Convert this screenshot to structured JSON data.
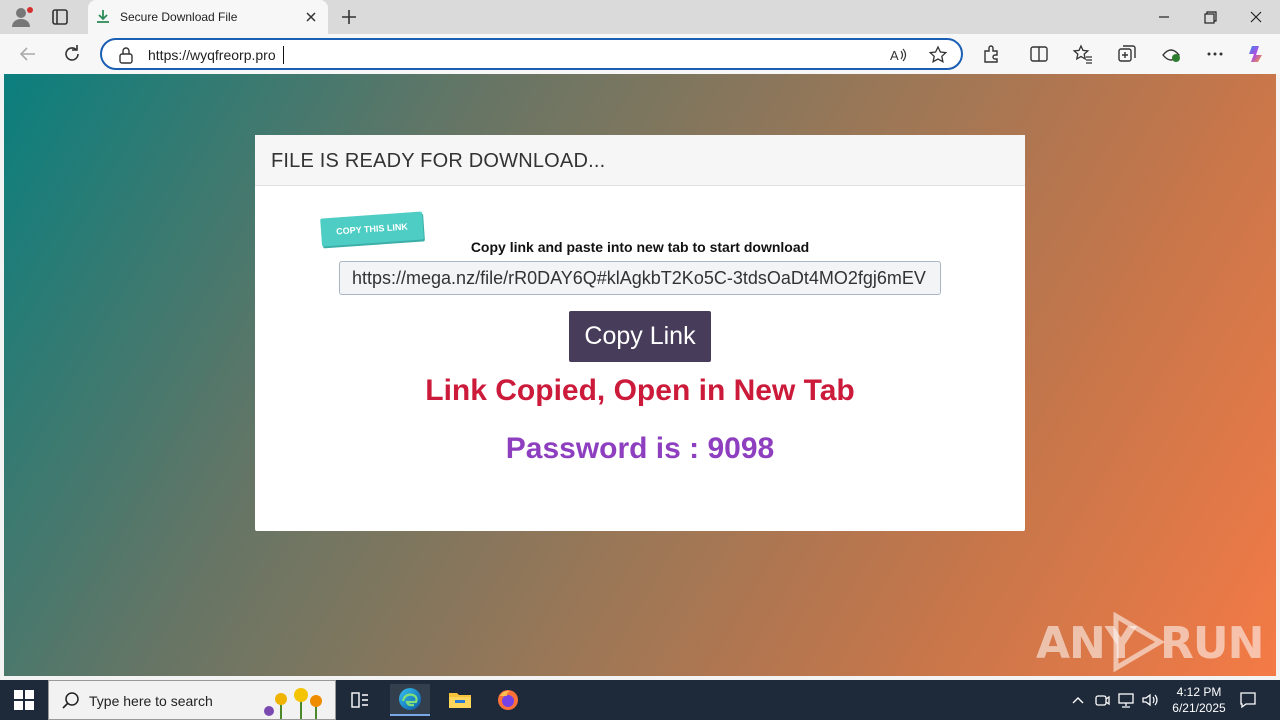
{
  "browser": {
    "tab": {
      "title": "Secure Download File"
    },
    "address": {
      "url": "https://wyqfreorp.pro"
    }
  },
  "page": {
    "header_title": "FILE IS READY FOR DOWNLOAD...",
    "badge_label": "COPY THIS LINK",
    "instruction": "Copy link and paste into new tab to start download",
    "link_value": "https://mega.nz/file/rR0DAY6Q#klAgkbT2Ko5C-3tdsOaDt4MO2fgj6mEV",
    "copy_button_label": "Copy Link",
    "copied_message": "Link Copied, Open in New Tab",
    "password_text": "Password is : 9098",
    "colors": {
      "copied": "#cc1a3a",
      "password": "#8e3fc0",
      "button": "#473d5b",
      "badge": "#4ecdc4"
    }
  },
  "watermark": {
    "left": "ANY",
    "right": "RUN"
  },
  "taskbar": {
    "search_placeholder": "Type here to search",
    "clock_time": "4:12 PM",
    "clock_date": "6/21/2025"
  },
  "icons": [
    "profile-icon",
    "tab-actions-icon",
    "download-icon",
    "close-icon",
    "plus-icon",
    "minimize-icon",
    "restore-icon",
    "back-icon",
    "refresh-icon",
    "lock-icon",
    "read-aloud-icon",
    "favorite-star-icon",
    "extensions-icon",
    "split-screen-icon",
    "favorites-icon",
    "collections-icon",
    "browser-essentials-icon",
    "more-icon",
    "copilot-icon",
    "windows-start-icon",
    "search-icon",
    "task-view-icon",
    "edge-icon",
    "file-explorer-icon",
    "firefox-icon",
    "chevron-up-icon",
    "network-icon",
    "volume-icon",
    "notification-icon"
  ]
}
